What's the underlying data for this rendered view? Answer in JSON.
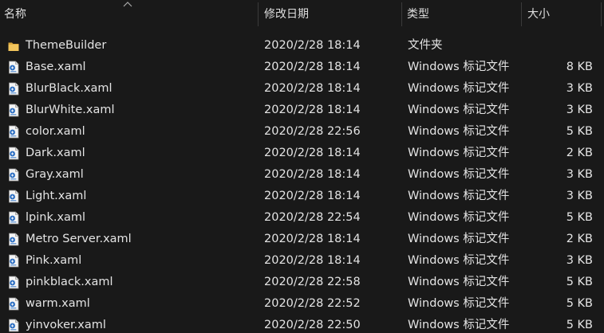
{
  "columns": {
    "name": "名称",
    "date": "修改日期",
    "type": "类型",
    "size": "大小"
  },
  "icons": {
    "folder": "folder-icon",
    "file": "xaml-file-icon"
  },
  "colors": {
    "background": "#191919",
    "text": "#e4e4e4",
    "folder": "#f2c55c"
  },
  "files": [
    {
      "name": "ThemeBuilder",
      "date": "2020/2/28 18:14",
      "type": "文件夹",
      "size": "",
      "kind": "folder"
    },
    {
      "name": "Base.xaml",
      "date": "2020/2/28 18:14",
      "type": "Windows 标记文件",
      "size": "8 KB",
      "kind": "file"
    },
    {
      "name": "BlurBlack.xaml",
      "date": "2020/2/28 18:14",
      "type": "Windows 标记文件",
      "size": "3 KB",
      "kind": "file"
    },
    {
      "name": "BlurWhite.xaml",
      "date": "2020/2/28 18:14",
      "type": "Windows 标记文件",
      "size": "3 KB",
      "kind": "file"
    },
    {
      "name": "color.xaml",
      "date": "2020/2/28 22:56",
      "type": "Windows 标记文件",
      "size": "5 KB",
      "kind": "file"
    },
    {
      "name": "Dark.xaml",
      "date": "2020/2/28 18:14",
      "type": "Windows 标记文件",
      "size": "2 KB",
      "kind": "file"
    },
    {
      "name": "Gray.xaml",
      "date": "2020/2/28 18:14",
      "type": "Windows 标记文件",
      "size": "3 KB",
      "kind": "file"
    },
    {
      "name": "Light.xaml",
      "date": "2020/2/28 18:14",
      "type": "Windows 标记文件",
      "size": "3 KB",
      "kind": "file"
    },
    {
      "name": "lpink.xaml",
      "date": "2020/2/28 22:54",
      "type": "Windows 标记文件",
      "size": "5 KB",
      "kind": "file"
    },
    {
      "name": "Metro Server.xaml",
      "date": "2020/2/28 18:14",
      "type": "Windows 标记文件",
      "size": "2 KB",
      "kind": "file"
    },
    {
      "name": "Pink.xaml",
      "date": "2020/2/28 18:14",
      "type": "Windows 标记文件",
      "size": "3 KB",
      "kind": "file"
    },
    {
      "name": "pinkblack.xaml",
      "date": "2020/2/28 22:58",
      "type": "Windows 标记文件",
      "size": "5 KB",
      "kind": "file"
    },
    {
      "name": "warm.xaml",
      "date": "2020/2/28 22:52",
      "type": "Windows 标记文件",
      "size": "5 KB",
      "kind": "file"
    },
    {
      "name": "yinvoker.xaml",
      "date": "2020/2/28 22:50",
      "type": "Windows 标记文件",
      "size": "5 KB",
      "kind": "file"
    }
  ]
}
